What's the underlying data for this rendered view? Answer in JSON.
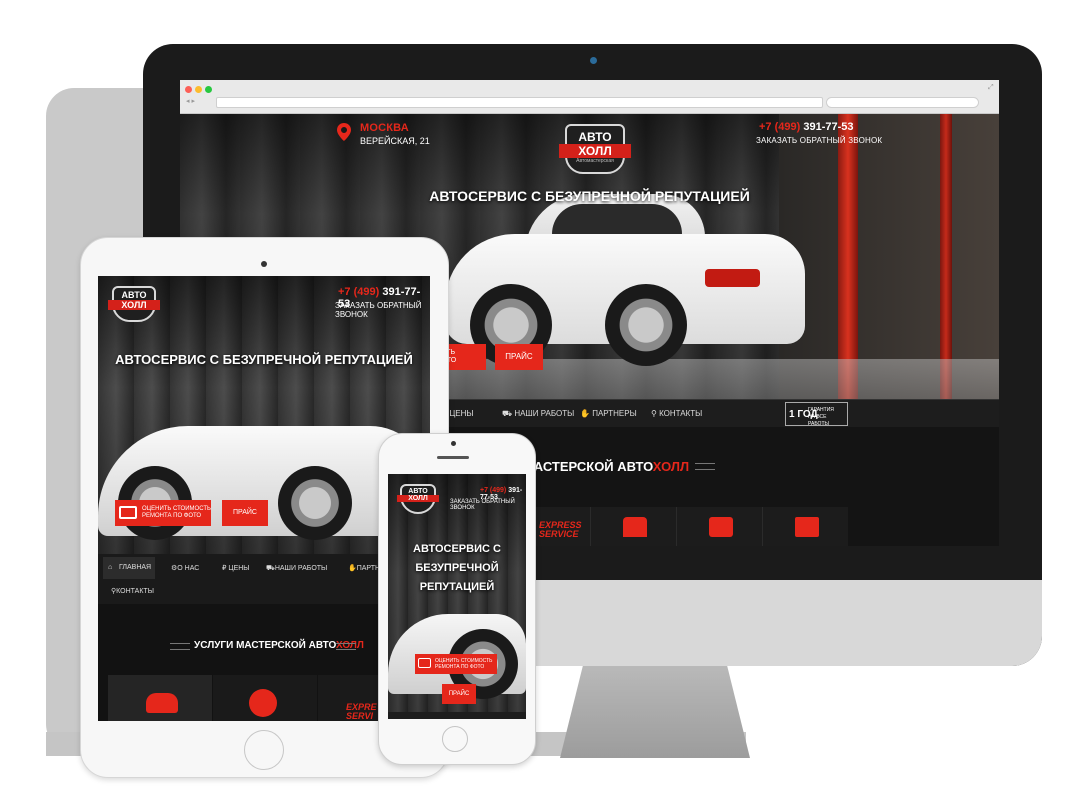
{
  "brand": {
    "logo_top": "АВТО",
    "logo_band": "ХОЛЛ",
    "logo_sub": "Автомастерская"
  },
  "desktop": {
    "city": "МОСКВА",
    "street": "ВЕРЕЙСКАЯ, 21",
    "phone_prefix": "+7 (499)",
    "phone_number": "391-77-53",
    "callback": "ЗАКАЗАТЬ ОБРАТНЫЙ ЗВОНОК",
    "headline": "АВТОСЕРВИС С БЕЗУПРЕЧНОЙ РЕПУТАЦИЕЙ",
    "photo_button": "ОЦЕНИТЬ СТОИМОСТЬ\nРЕМОНТА ПО ФОТО",
    "photo_button_visible": "ОСТЬ\nФОТО",
    "price_button": "ПРАЙС",
    "nav": [
      {
        "icon": "ruble-icon",
        "glyph": "₽",
        "label": "ЦЕНЫ"
      },
      {
        "icon": "car-icon",
        "glyph": "🚗",
        "label": "НАШИ РАБОТЫ"
      },
      {
        "icon": "handshake-icon",
        "glyph": "🤝",
        "label": "ПАРТНЕРЫ"
      },
      {
        "icon": "location-icon",
        "glyph": "📍",
        "label": "КОНТАКТЫ"
      }
    ],
    "guarantee_year": "1 ГОД",
    "guarantee_text": "ГАРАНТИЯ\nНА ВСЕ РАБОТЫ",
    "services_title_prefix": "И МАСТЕРСКОЙ ",
    "services_title_auto": "АВТО",
    "services_title_holl": "ХОЛЛ",
    "express_label": "EXPRESS\nSERVICE"
  },
  "tablet": {
    "phone_prefix": "+7 (499)",
    "phone_number": "391-77-53",
    "callback": "ЗАКАЗАТЬ ОБРАТНЫЙ ЗВОНОК",
    "headline": "АВТОСЕРВИС С БЕЗУПРЕЧНОЙ РЕПУТАЦИЕЙ",
    "photo_button": "ОЦЕНИТЬ СТОИМОСТЬ\nРЕМОНТА ПО ФОТО",
    "price_button": "ПРАЙС",
    "nav": {
      "home": "ГЛАВНАЯ",
      "about": "О НАС",
      "prices": "ЦЕНЫ",
      "works": "НАШИ РАБОТЫ",
      "partners": "ПАРТНЕ",
      "contacts": "КОНТАКТЫ"
    },
    "services_title_prefix": "УСЛУГИ МАСТЕРСКОЙ ",
    "services_title_auto": "АВТО",
    "services_title_holl": "ХОЛЛ",
    "express_label": "EXPRE\nSERVI"
  },
  "phone": {
    "phone_prefix": "+7 (499)",
    "phone_number": "391-77-53",
    "callback": "ЗАКАЗАТЬ ОБРАТНЫЙ ЗВОНОК",
    "headline_line1": "АВТОСЕРВИС С",
    "headline_line2": "БЕЗУПРЕЧНОЙ РЕПУТАЦИЕЙ",
    "photo_button": "ОЦЕНИТЬ СТОИМОСТЬ\nРЕМОНТА ПО ФОТО",
    "price_button": "ПРАЙС"
  },
  "colors": {
    "accent": "#e5271b",
    "dark": "#121212",
    "text": "#ffffff"
  }
}
